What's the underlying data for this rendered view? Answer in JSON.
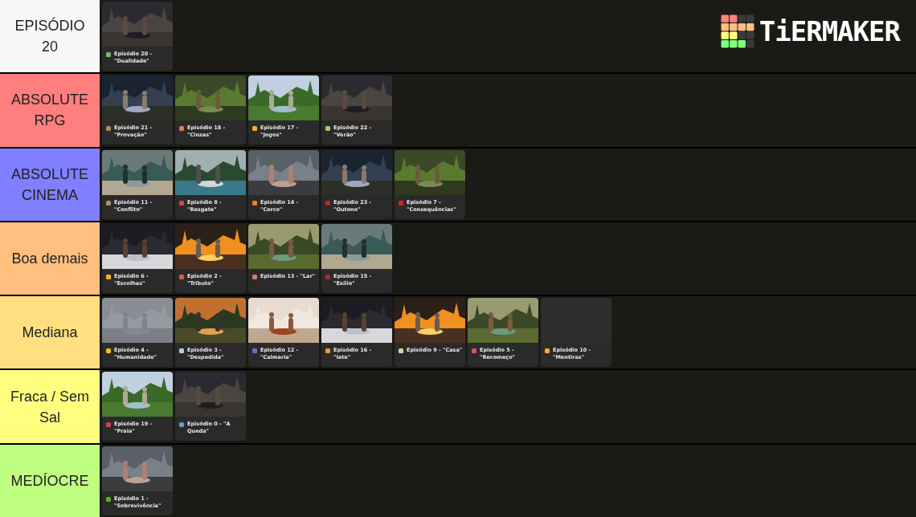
{
  "logo": {
    "text": "TiERMAKER"
  },
  "tiers": [
    {
      "label": "EPISÓDIO 20",
      "color": "#f7f7f7",
      "items": [
        {
          "caption": "Episódio 20 - \"Dualidade\"",
          "color": "#6fbf5f",
          "kind": "picture"
        }
      ]
    },
    {
      "label": "ABSOLUTE RPG",
      "color": "#ff7f7f",
      "items": [
        {
          "caption": "Episódio 21 - \"Provação\"",
          "color": "#b08a60",
          "kind": "picture"
        },
        {
          "caption": "Episódio 18 - \"Cinzas\"",
          "color": "#e07a50",
          "kind": "picture"
        },
        {
          "caption": "Episódio 17 - \"Jogos\"",
          "color": "#f0b030",
          "kind": "picture"
        },
        {
          "caption": "Episódio 22 - \"Verão\"",
          "color": "#9fcf5f",
          "kind": "picture"
        }
      ]
    },
    {
      "label": "ABSOLUTE CINEMA",
      "color": "#7f7fff",
      "items": [
        {
          "caption": "Episódio 11 - \"Conflito\"",
          "color": "#b08a60",
          "kind": "picture"
        },
        {
          "caption": "Episódio 8 - \"Resgate\"",
          "color": "#e04050",
          "kind": "picture"
        },
        {
          "caption": "Episódio 14 - \"Cerco\"",
          "color": "#f08020",
          "kind": "picture"
        },
        {
          "caption": "Episódio 23 - \"Outono\"",
          "color": "#d02020",
          "kind": "picture"
        },
        {
          "caption": "Episódio 7 - \"Consequências\"",
          "color": "#e02020",
          "kind": "picture"
        }
      ]
    },
    {
      "label": "Boa demais",
      "color": "#ffbf7f",
      "items": [
        {
          "caption": "Episódio 6 - \"Escolhas\"",
          "color": "#f0b020",
          "kind": "picture"
        },
        {
          "caption": "Episódio 2 - \"Tributo\"",
          "color": "#d06040",
          "kind": "picture"
        },
        {
          "caption": "Episódio 13 - \"Lar\"",
          "color": "#d08060",
          "kind": "picture"
        },
        {
          "caption": "Episódio 15 - \"Exílio\"",
          "color": "#a03030",
          "kind": "picture"
        }
      ]
    },
    {
      "label": "Mediana",
      "color": "#ffdf7f",
      "items": [
        {
          "caption": "Episódio 4 - \"Humanidade\"",
          "color": "#f0c020",
          "kind": "picture"
        },
        {
          "caption": "Episódio 3 - \"Despedida\"",
          "color": "#c0c8d0",
          "kind": "picture"
        },
        {
          "caption": "Episódio 12 - \"Calmaria\"",
          "color": "#8060d0",
          "kind": "picture"
        },
        {
          "caption": "Episódio 16 - \"Iate\"",
          "color": "#e0a040",
          "kind": "picture"
        },
        {
          "caption": "Episódio 9 - \"Casa\"",
          "color": "#e0d0a0",
          "kind": "picture"
        },
        {
          "caption": "Episódio 5 - \"Recomeço\"",
          "color": "#e05060",
          "kind": "picture"
        },
        {
          "caption": "Episódio 10 - \"Mentiras\"",
          "color": "#f0b020"
        }
      ]
    },
    {
      "label": "Fraca / Sem Sal",
      "color": "#ffff7f",
      "items": [
        {
          "caption": "Episódio 19 - \"Praia\"",
          "color": "#d04040",
          "kind": "picture"
        },
        {
          "caption": "Episódio 0 - \"A Queda\"",
          "color": "#60a0c0",
          "kind": "picture"
        }
      ]
    },
    {
      "label": "MEDÍOCRE",
      "color": "#bfff7f",
      "items": [
        {
          "caption": "Episódio 1 - \"Sobrevivência\"",
          "color": "#50b030",
          "kind": "picture"
        }
      ]
    }
  ]
}
